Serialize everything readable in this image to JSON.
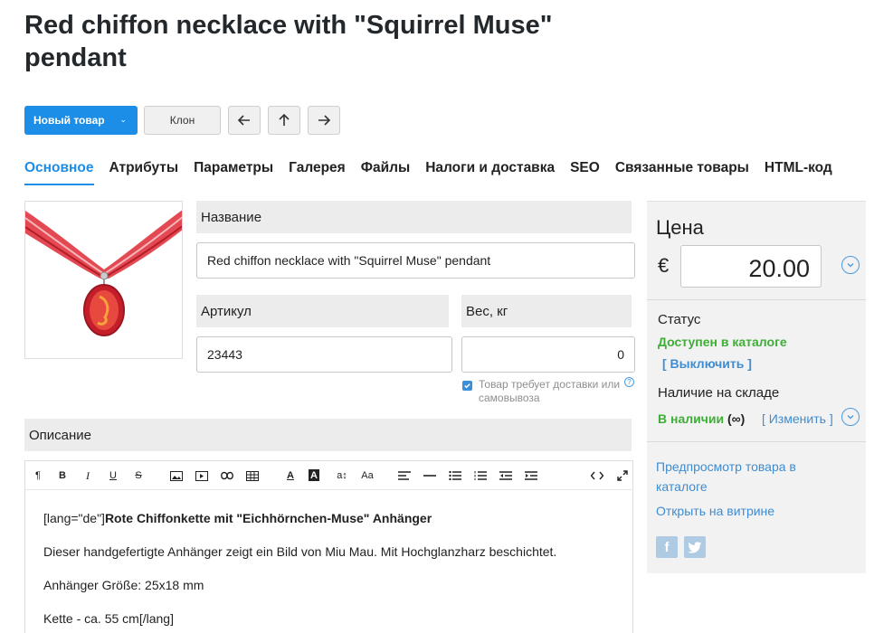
{
  "page": {
    "title": "Red chiffon necklace with \"Squirrel Muse\" pendant"
  },
  "toolbar": {
    "new_product": "Новый товар",
    "clone": "Клон"
  },
  "tabs": [
    {
      "label": "Основное",
      "active": true
    },
    {
      "label": "Атрибуты"
    },
    {
      "label": "Параметры"
    },
    {
      "label": "Галерея"
    },
    {
      "label": "Файлы"
    },
    {
      "label": "Налоги и доставка"
    },
    {
      "label": "SEO"
    },
    {
      "label": "Связанные товары"
    },
    {
      "label": "HTML-код"
    }
  ],
  "form": {
    "name_label": "Название",
    "name_value": "Red chiffon necklace with \"Squirrel Muse\" pendant",
    "sku_label": "Артикул",
    "sku_value": "23443",
    "weight_label": "Вес, кг",
    "weight_value": "0",
    "shipping_checkbox_label": "Товар требует доставки или самовывоза",
    "shipping_checked": true,
    "description_label": "Описание"
  },
  "editor": {
    "toolbar": [
      "paragraph-icon",
      "bold-icon",
      "italic-icon",
      "underline-icon",
      "strikethrough-icon",
      "image-icon",
      "video-icon",
      "link-icon",
      "table-icon",
      "font-color-icon",
      "background-color-icon",
      "font-size-icon",
      "font-family-icon",
      "align-icon",
      "horizontal-rule-icon",
      "bullet-list-icon",
      "numbered-list-icon",
      "outdent-icon",
      "indent-icon",
      "code-icon",
      "fullscreen-icon"
    ],
    "content": {
      "lang_prefix": "[lang=\"de\"]",
      "heading": "Rote Chiffonkette mit \"Eichhörnchen-Muse\" Anhänger",
      "p1": "Dieser handgefertigte Anhänger zeigt ein Bild von Miu Mau. Mit Hochglanzharz beschichtet.",
      "p2": "Anhänger Größe: 25x18 mm",
      "p3": "Kette - ca. 55 cm[/lang]"
    }
  },
  "sidebar": {
    "price_title": "Цена",
    "currency": "€",
    "price_value": "20.00",
    "status_label": "Статус",
    "status_value": "Доступен в каталоге",
    "disable_link": "[ Выключить ]",
    "stock_label": "Наличие на складе",
    "stock_value": "В наличии",
    "stock_qty": "(∞)",
    "change_link": "[ Изменить ]",
    "preview_link": "Предпросмотр товара в каталоге",
    "storefront_link": "Открыть на витрине",
    "social": [
      "facebook-icon",
      "twitter-icon"
    ]
  },
  "colors": {
    "accent": "#1d8ee7",
    "success": "#3eae36",
    "link": "#3f8cd1"
  }
}
